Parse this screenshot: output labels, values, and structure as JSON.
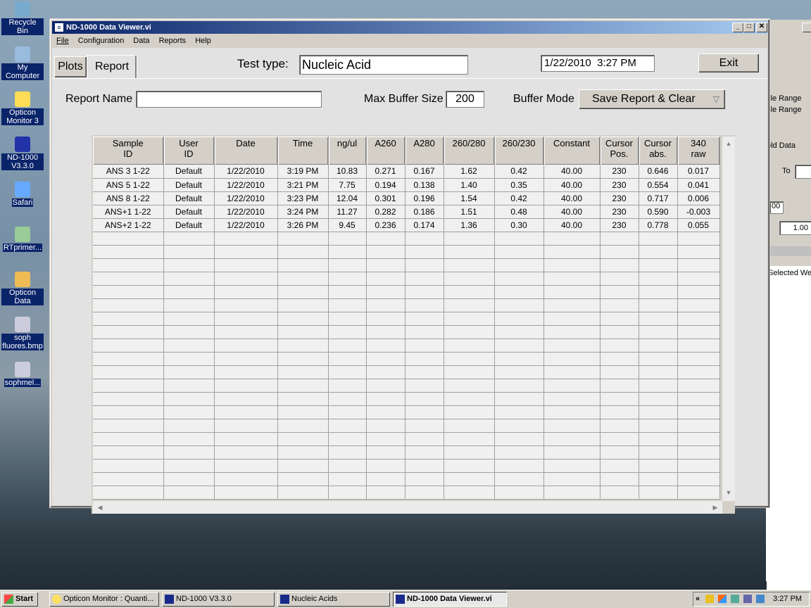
{
  "desktop": {
    "icons": [
      {
        "label": "Recycle Bin",
        "icon": "recycle-bin-icon"
      },
      {
        "label": "My Computer",
        "icon": "computer-icon"
      },
      {
        "label": "Opticon Monitor 3",
        "icon": "bulb-icon"
      },
      {
        "label": "ND-1000 V3.3.0",
        "icon": "nd1000-icon"
      },
      {
        "label": "Safari",
        "icon": "safari-icon"
      },
      {
        "label": "RTprimer...",
        "icon": "file-icon"
      },
      {
        "label": "Opticon Data",
        "icon": "folder-icon"
      },
      {
        "label": "soph fluores.bmp",
        "icon": "image-file-icon"
      },
      {
        "label": "sophmel...",
        "icon": "image-file-icon"
      }
    ]
  },
  "background_window": {
    "texts": [
      "cle Range",
      "cle Range",
      "old Data",
      "To",
      "00",
      "1.00",
      "Selected We"
    ]
  },
  "window": {
    "title": "ND-1000 Data Viewer.vi",
    "menu": [
      "File",
      "Configuration",
      "Data",
      "Reports",
      "Help"
    ],
    "tabs": [
      "Plots",
      "Report"
    ],
    "test_type_label": "Test type:",
    "test_type_value": "Nucleic Acid",
    "datetime": "1/22/2010  3:27 PM",
    "exit_label": "Exit",
    "report_name_label": "Report Name",
    "report_name_value": "",
    "max_buffer_label": "Max Buffer Size",
    "max_buffer_value": "200",
    "buffer_mode_label": "Buffer Mode",
    "buffer_mode_value": "Save Report & Clear"
  },
  "table": {
    "columns": [
      [
        "Sample",
        "ID"
      ],
      [
        "User",
        "ID"
      ],
      [
        "Date",
        ""
      ],
      [
        "Time",
        ""
      ],
      [
        "ng/ul",
        ""
      ],
      [
        "A260",
        ""
      ],
      [
        "A280",
        ""
      ],
      [
        "260/280",
        ""
      ],
      [
        "260/230",
        ""
      ],
      [
        "Constant",
        ""
      ],
      [
        "Cursor",
        "Pos."
      ],
      [
        "Cursor",
        "abs."
      ],
      [
        "340",
        "raw"
      ]
    ],
    "rows": [
      [
        "ANS 3 1-22",
        "Default",
        "1/22/2010",
        "3:19 PM",
        "10.83",
        "0.271",
        "0.167",
        "1.62",
        "0.42",
        "40.00",
        "230",
        "0.646",
        "0.017"
      ],
      [
        "ANS 5 1-22",
        "Default",
        "1/22/2010",
        "3:21 PM",
        "7.75",
        "0.194",
        "0.138",
        "1.40",
        "0.35",
        "40.00",
        "230",
        "0.554",
        "0.041"
      ],
      [
        "ANS 8 1-22",
        "Default",
        "1/22/2010",
        "3:23 PM",
        "12.04",
        "0.301",
        "0.196",
        "1.54",
        "0.42",
        "40.00",
        "230",
        "0.717",
        "0.006"
      ],
      [
        "ANS+1 1-22",
        "Default",
        "1/22/2010",
        "3:24 PM",
        "11.27",
        "0.282",
        "0.186",
        "1.51",
        "0.48",
        "40.00",
        "230",
        "0.590",
        "-0.003"
      ],
      [
        "ANS+2 1-22",
        "Default",
        "1/22/2010",
        "3:26 PM",
        "9.45",
        "0.236",
        "0.174",
        "1.36",
        "0.30",
        "40.00",
        "230",
        "0.778",
        "0.055"
      ]
    ],
    "empty_rows": 20
  },
  "taskbar": {
    "start_label": "Start",
    "buttons": [
      {
        "label": "Opticon Monitor : Quanti...",
        "active": false
      },
      {
        "label": "ND-1000 V3.3.0",
        "active": false
      },
      {
        "label": "Nucleic Acids",
        "active": false
      },
      {
        "label": "ND-1000 Data Viewer.vi",
        "active": true
      }
    ],
    "clock": "3:27 PM"
  }
}
